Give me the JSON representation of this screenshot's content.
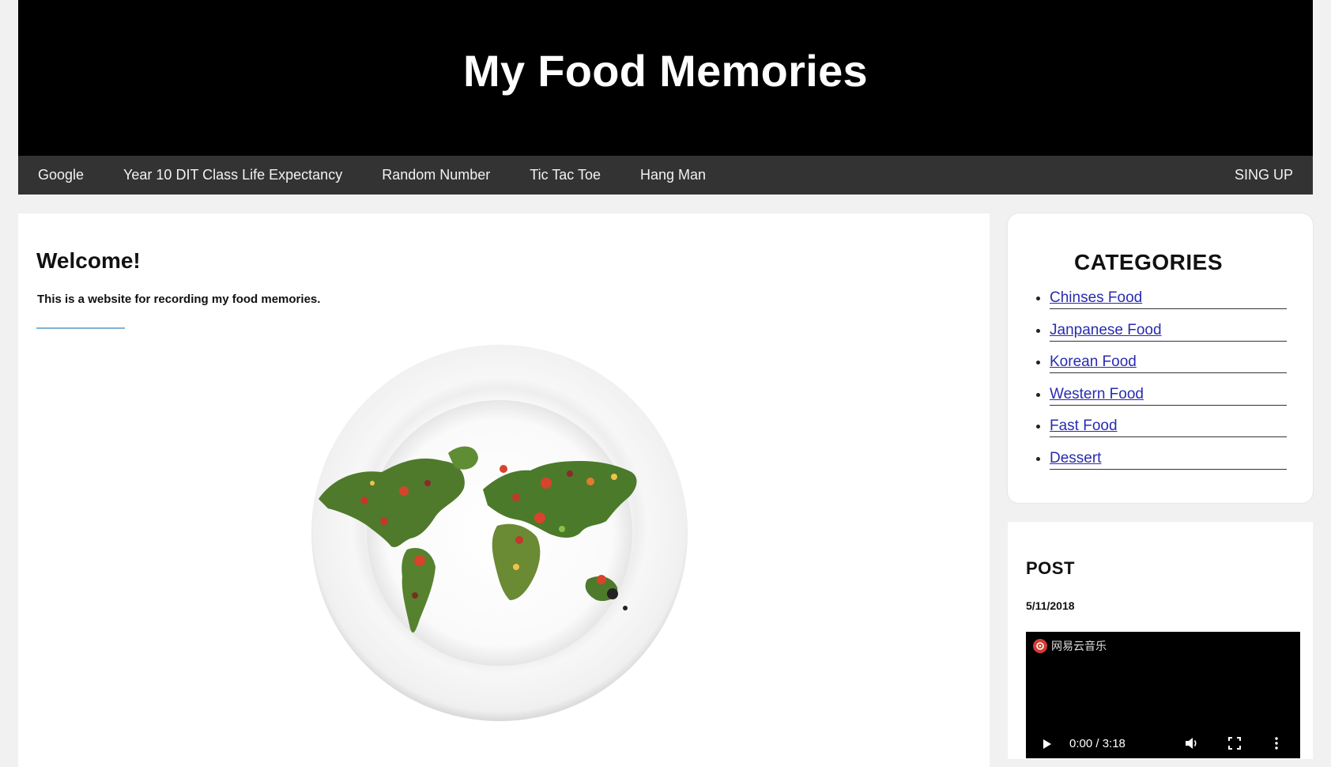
{
  "header": {
    "title": "My Food Memories"
  },
  "nav": {
    "items": [
      {
        "label": "Google"
      },
      {
        "label": "Year 10 DIT Class Life Expectancy"
      },
      {
        "label": "Random Number"
      },
      {
        "label": "Tic Tac Toe"
      },
      {
        "label": "Hang Man"
      }
    ],
    "signup_label": "SING UP"
  },
  "main": {
    "heading": "Welcome!",
    "intro": "This is a website for recording my food memories.",
    "image_icon": "world-map-food-plate"
  },
  "categories": {
    "title": "CATEGORIES",
    "items": [
      {
        "label": "Chinses Food"
      },
      {
        "label": "Janpanese Food"
      },
      {
        "label": "Korean Food"
      },
      {
        "label": "Western Food"
      },
      {
        "label": "Fast Food"
      },
      {
        "label": "Dessert"
      }
    ]
  },
  "post": {
    "title": "POST",
    "date": "5/11/2018",
    "player": {
      "brand": "网易云音乐",
      "time": "0:00 / 3:18"
    }
  },
  "colors": {
    "header_bg": "#000000",
    "nav_bg": "#333333",
    "link": "#2a2bb0",
    "page_bg": "#f1f1f1",
    "brand_red": "#d43c33"
  }
}
